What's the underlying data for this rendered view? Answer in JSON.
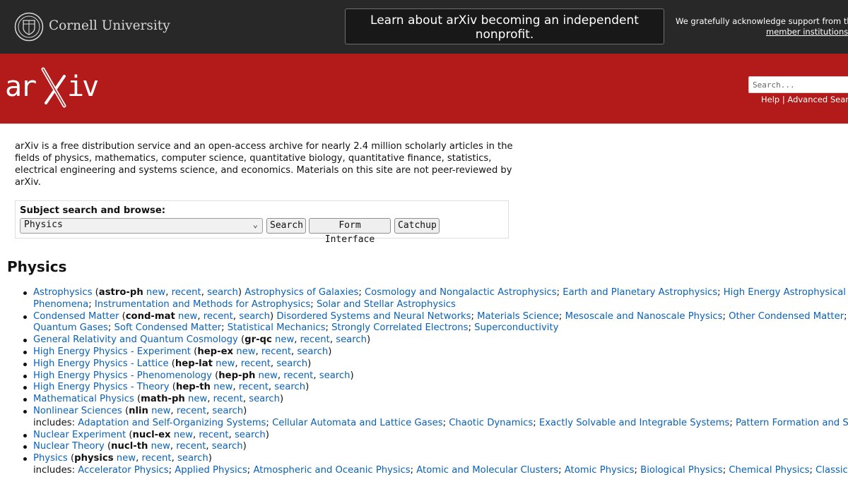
{
  "topbar": {
    "institution": "Cornell University",
    "notice": "Learn about arXiv becoming an independent nonprofit.",
    "support_text": "We gratefully acknowledge support from the",
    "support_link": "member institutions,"
  },
  "header": {
    "logo_text": "arXiv",
    "search_placeholder": "Search...",
    "help": "Help",
    "separator": "|",
    "advanced": "Advanced Search"
  },
  "intro": "arXiv is a free distribution service and an open-access archive for nearly 2.4 million scholarly articles in the fields of physics, mathematics, computer science, quantitative biology, quantitative finance, statistics, electrical engineering and systems science, and economics. Materials on this site are not peer-reviewed by arXiv.",
  "subject_search": {
    "label": "Subject search and browse:",
    "selected": "Physics",
    "buttons": [
      "Search",
      "Form Interface",
      "Catchup"
    ]
  },
  "section_title": "Physics",
  "links": {
    "new": "new",
    "recent": "recent",
    "search": "search",
    "includes": "includes:"
  },
  "archives": [
    {
      "name": "Astrophysics",
      "code": "astro-ph",
      "subs": [
        "Astrophysics of Galaxies",
        "Cosmology and Nongalactic Astrophysics",
        "Earth and Planetary Astrophysics",
        "High Energy Astrophysical Phenomena",
        "Instrumentation and Methods for Astrophysics",
        "Solar and Stellar Astrophysics"
      ],
      "line_split": 4,
      "first_line_tail": "High Energy Astrophysical Ph",
      "second_line_head": "Methods for Astrophysics"
    },
    {
      "name": "Condensed Matter",
      "code": "cond-mat",
      "subs": [
        "Disordered Systems and Neural Networks",
        "Materials Science",
        "Mesoscale and Nanoscale Physics",
        "Other Condensed Matter",
        "Quantum Gases",
        "Soft Condensed Matter",
        "Statistical Mechanics",
        "Strongly Correlated Electrons",
        "Superconductivity"
      ],
      "first_line_tail": "Qu",
      "second_line_head": "Matter"
    },
    {
      "name": "General Relativity and Quantum Cosmology",
      "code": "gr-qc"
    },
    {
      "name": "High Energy Physics - Experiment",
      "code": "hep-ex"
    },
    {
      "name": "High Energy Physics - Lattice",
      "code": "hep-lat"
    },
    {
      "name": "High Energy Physics - Phenomenology",
      "code": "hep-ph"
    },
    {
      "name": "High Energy Physics - Theory",
      "code": "hep-th"
    },
    {
      "name": "Mathematical Physics",
      "code": "math-ph"
    },
    {
      "name": "Nonlinear Sciences",
      "code": "nlin",
      "includes": [
        "Adaptation and Self-Organizing Systems",
        "Cellular Automata and Lattice Gases",
        "Chaotic Dynamics",
        "Exactly Solvable and Integrable Systems",
        "Pattern Formation and Solitons"
      ],
      "includes_tail": "Pattern Formation and Soli"
    },
    {
      "name": "Nuclear Experiment",
      "code": "nucl-ex"
    },
    {
      "name": "Nuclear Theory",
      "code": "nucl-th"
    },
    {
      "name": "Physics",
      "code": "physics",
      "includes": [
        "Accelerator Physics",
        "Applied Physics",
        "Atmospheric and Oceanic Physics",
        "Atomic and Molecular Clusters",
        "Atomic Physics",
        "Biological Physics",
        "Chemical Physics",
        "Classical"
      ],
      "includes_tail": "Classical"
    }
  ],
  "colors": {
    "red": "#b31b1b",
    "topbar": "#282828",
    "link": "#0b61b5"
  }
}
